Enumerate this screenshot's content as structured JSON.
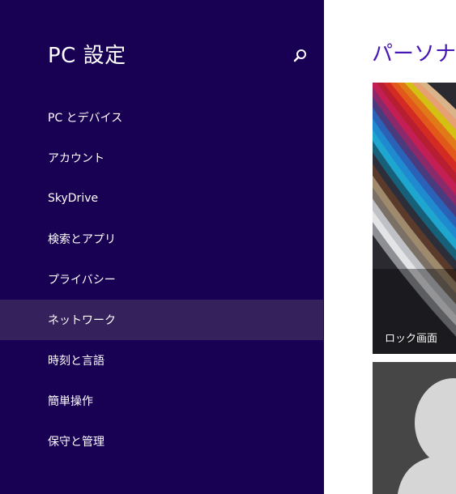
{
  "nav": {
    "title": "PC 設定",
    "search_icon": "search-icon",
    "items": [
      {
        "label": "PC とデバイス",
        "selected": false
      },
      {
        "label": "アカウント",
        "selected": false
      },
      {
        "label": "SkyDrive",
        "selected": false
      },
      {
        "label": "検索とアプリ",
        "selected": false
      },
      {
        "label": "プライバシー",
        "selected": false
      },
      {
        "label": "ネットワーク",
        "selected": true
      },
      {
        "label": "時刻と言語",
        "selected": false
      },
      {
        "label": "簡単操作",
        "selected": false
      },
      {
        "label": "保守と管理",
        "selected": false
      }
    ]
  },
  "content": {
    "heading": "パーソナル",
    "lock_screen_tile": {
      "label": "ロック画面"
    },
    "account_picture_tile": {
      "icon": "user-silhouette-icon"
    }
  },
  "colors": {
    "nav_background": "#180052",
    "nav_selected": "#35225c",
    "heading_accent": "#4617b4",
    "account_tile_background": "#464646"
  }
}
